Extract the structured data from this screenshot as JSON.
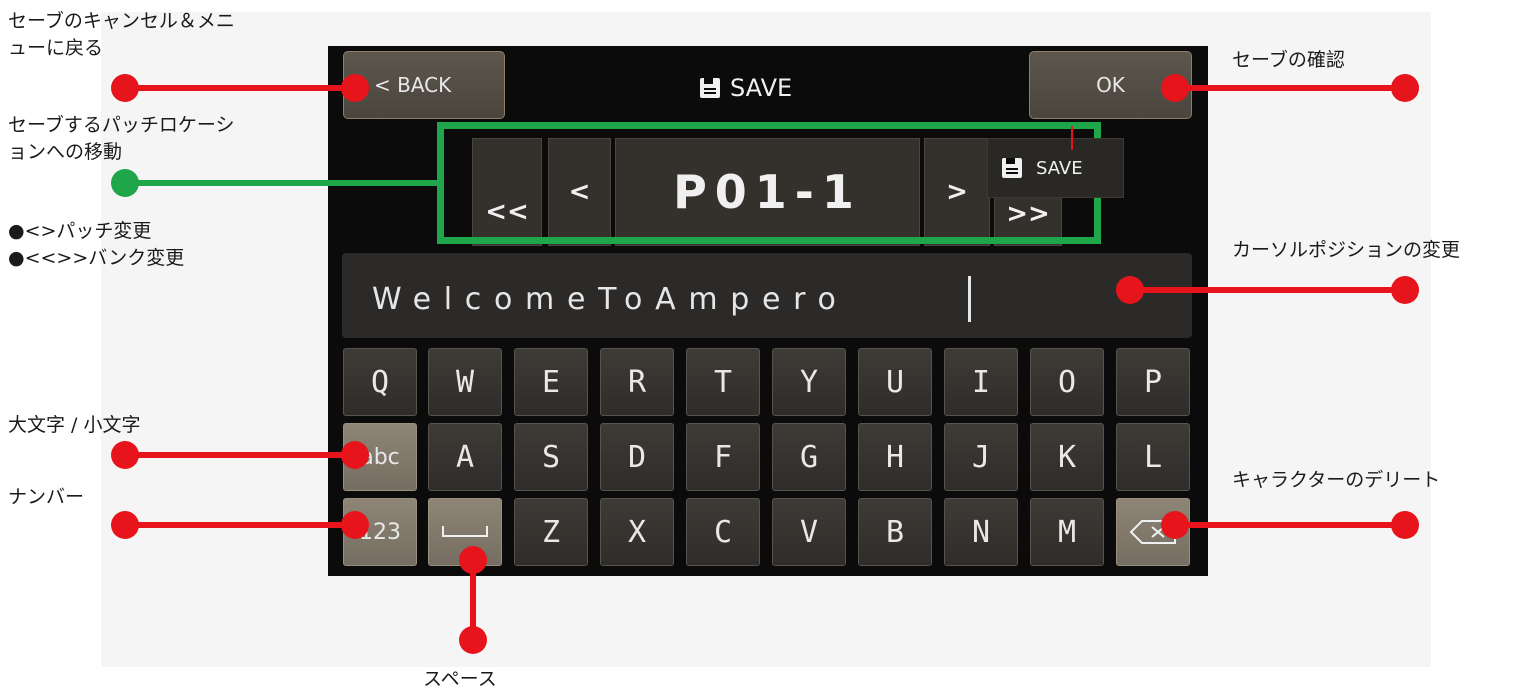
{
  "device": {
    "back_label": "< BACK",
    "title": "SAVE",
    "ok_label": "OK",
    "nav": {
      "bank_prev": "<<",
      "prev": "<",
      "patch": "P01-1",
      "next": ">",
      "bank_next": ">>"
    },
    "floating_save_label": "SAVE",
    "name_value": "WelcomeToAmpero",
    "keyboard": {
      "row1": [
        "Q",
        "W",
        "E",
        "R",
        "T",
        "Y",
        "U",
        "I",
        "O",
        "P"
      ],
      "row2": [
        "abc",
        "A",
        "S",
        "D",
        "F",
        "G",
        "H",
        "J",
        "K",
        "L"
      ],
      "row3": [
        "123",
        "space",
        "Z",
        "X",
        "C",
        "V",
        "B",
        "N",
        "M",
        "backspace"
      ]
    }
  },
  "annotations": {
    "back": "セーブのキャンセル＆メニ\nューに戻る",
    "ok": "セーブの確認",
    "move": "セーブするパッチロケーシ\nョンへの移動",
    "patch_change": "●<>パッチ変更",
    "bank_change": "●<<>>バンク変更",
    "cursor": "カーソルポジションの変更",
    "case": "大文字 / 小文字",
    "number": "ナンバー",
    "delete": "キャラクターのデリート",
    "space": "スペース"
  },
  "colors": {
    "callout_red": "#e8141b",
    "callout_green": "#1fa64a",
    "screen_bg": "#0b0b0b"
  }
}
